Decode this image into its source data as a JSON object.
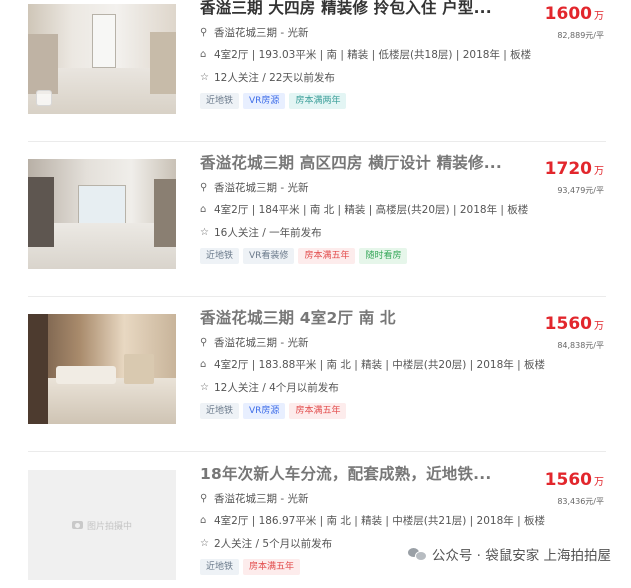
{
  "listings": [
    {
      "title": "香溢三期 大四房 精装修 拎包入住 户型...",
      "community": "香溢花城三期 - 光新",
      "info": "4室2厅 | 193.03平米 | 南 | 精装 | 低楼层(共18层) | 2018年 | 板楼",
      "follow": "12人关注 / 22天以前发布",
      "tags": [
        "近地铁",
        "VR房源",
        "房本满两年"
      ],
      "price": "1600",
      "price_unit": "万",
      "unit_price": "82,889元/平",
      "photo_icon": "vr-icon"
    },
    {
      "title": "香溢花城三期 高区四房 横厅设计 精装修...",
      "community": "香溢花城三期 - 光新",
      "info": "4室2厅 | 184平米 | 南 北 | 精装 | 高楼层(共20层) | 2018年 | 板楼",
      "follow": "16人关注 / 一年前发布",
      "tags": [
        "近地铁",
        "VR看装修",
        "房本满五年",
        "随时看房"
      ],
      "price": "1720",
      "price_unit": "万",
      "unit_price": "93,479元/平"
    },
    {
      "title": "香溢花城三期 4室2厅 南 北",
      "community": "香溢花城三期 - 光新",
      "info": "4室2厅 | 183.88平米 | 南 北 | 精装 | 中楼层(共20层) | 2018年 | 板楼",
      "follow": "12人关注 / 4个月以前发布",
      "tags": [
        "近地铁",
        "VR房源",
        "房本满五年"
      ],
      "price": "1560",
      "price_unit": "万",
      "unit_price": "84,838元/平"
    },
    {
      "title": "18年次新人车分流，配套成熟，近地铁...",
      "community": "香溢花城三期 - 光新",
      "info": "4室2厅 | 186.97平米 | 南 北 | 精装 | 中楼层(共21层) | 2018年 | 板楼",
      "follow": "2人关注 / 5个月以前发布",
      "tags": [
        "近地铁",
        "房本满五年"
      ],
      "price": "1560",
      "price_unit": "万",
      "unit_price": "83,436元/平",
      "photo_placeholder": "图片拍摄中"
    }
  ],
  "watermark": "公众号 · 袋鼠安家 上海拍拍屋",
  "colors": {
    "price": "#e2262c",
    "title": "#333333"
  }
}
